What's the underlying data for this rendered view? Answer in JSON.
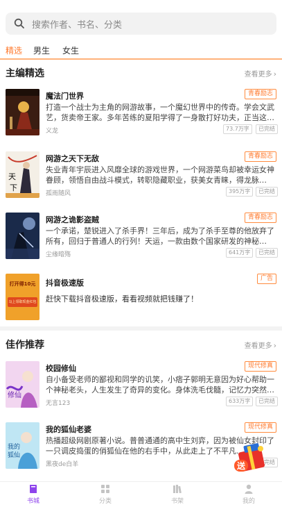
{
  "search": {
    "placeholder": "搜索作者、书名、分类"
  },
  "tabs": [
    {
      "label": "精选",
      "active": true
    },
    {
      "label": "男生",
      "active": false
    },
    {
      "label": "女生",
      "active": false
    }
  ],
  "sections": [
    {
      "title": "主编精选",
      "more": "查看更多",
      "books": [
        {
          "title": "魔法门世界",
          "tag": "青春励志",
          "desc": "打造一个战士为主角的网游故事，一个魔幻世界中的传奇。学会文武艺，货卖帝王家。多年苦练的夏阳学得了一身散打好功夫，正当这…",
          "author": "义龙",
          "words": "73.7万字",
          "status": "已完结"
        },
        {
          "title": "网游之天下无敌",
          "tag": "青春励志",
          "desc": "失业青年宇辰进入风靡全球的游戏世界，一个网游菜鸟却被幸运女神眷顾，领悟自由战斗模式，转职隐藏职业，获美女青睐，得龙脉…",
          "author": "孤雨随风",
          "words": "395万字",
          "status": "已完结"
        },
        {
          "title": "网游之诡影盗贼",
          "tag": "青春励志",
          "desc": "一个承诺，楚锐进入了杀手界！三年后，成为了杀手至尊的他放弃了所有，回归于普通人的行列！天运，一款由数个国家研发的神秘…",
          "author": "尘缘暗殇",
          "words": "641万字",
          "status": "已完结"
        }
      ],
      "ad": {
        "title": "抖音极速版",
        "tag": "广告",
        "desc": "赶快下载抖音极速版，看看视频就把钱赚了！",
        "cover_text": "打开得10元",
        "cover_sub": "马上领取现金红包"
      }
    },
    {
      "title": "佳作推荐",
      "more": "查看更多",
      "books": [
        {
          "title": "校园修仙",
          "tag": "现代修真",
          "desc": "自小备受老师的鄙视和同学的讥笑，小痞子郭明无意因为好心帮助一个神秘老头，人生发生了奇异的变化。身体洗毛伐髓，记忆力突然…",
          "author": "无言123",
          "words": "633万字",
          "status": "已完结"
        },
        {
          "title": "我的狐仙老婆",
          "tag": "现代修真",
          "desc": "热播超级网剧原著小说。普普通通的高中生刘弈，因为被仙女封印了一只调皮捣蛋的俏狐仙在他的右手中，从此走上了不平凡…",
          "author": "黑夜de白羊",
          "words": "",
          "status": "已完结"
        }
      ]
    }
  ],
  "bottom_nav": [
    {
      "label": "书城",
      "icon": "book-city-icon",
      "active": true
    },
    {
      "label": "分类",
      "icon": "category-icon",
      "active": false
    },
    {
      "label": "书架",
      "icon": "bookshelf-icon",
      "active": false
    },
    {
      "label": "我的",
      "icon": "profile-icon",
      "active": false
    }
  ],
  "float_badge": {
    "text": "送",
    "icon": "gift-icon"
  },
  "colors": {
    "accent": "#ff7a2e",
    "nav_active": "#8e44ec",
    "tag_border": "#ff8a3d",
    "muted": "#9a9a9a"
  }
}
